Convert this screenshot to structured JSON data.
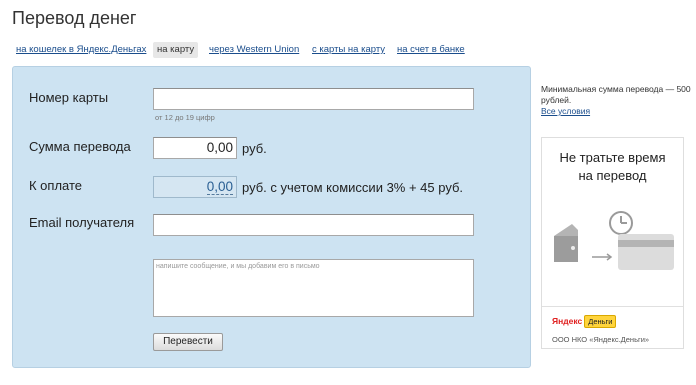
{
  "page": {
    "title": "Перевод денег"
  },
  "tabs": [
    {
      "label": "на кошелек в Яндекс.Деньгах"
    },
    {
      "label": "на карту"
    },
    {
      "label": "через Western Union"
    },
    {
      "label": "с карты на карту"
    },
    {
      "label": "на счет в банке"
    }
  ],
  "form": {
    "card_number_label": "Номер карты",
    "card_number_value": "",
    "card_number_hint": "от 12 до 19 цифр",
    "amount_label": "Сумма перевода",
    "amount_value": "0,00",
    "amount_currency": "руб.",
    "payment_label": "К оплате",
    "payment_value": "0,00",
    "payment_note": "руб. с учетом комиссии 3% + 45 руб.",
    "email_label": "Email получателя",
    "email_value": "",
    "message_placeholder": "напишите сообщение, и мы добавим его в письмо",
    "submit_label": "Перевести"
  },
  "sidebar": {
    "min_amount_text": "Минимальная сумма перевода — 500 рублей.",
    "all_terms_link": "Все условия"
  },
  "ad": {
    "headline_line1": "Не тратьте время",
    "headline_line2": "на перевод",
    "logo_ya": "Яндекс",
    "logo_dengi": "Деньги",
    "org": "ООО НКО «Яндекс.Деньги»"
  },
  "colors": {
    "panel_bg": "#cde3f2",
    "link": "#1a4d8c",
    "logo_red": "#e02020",
    "logo_yellow": "#ffd43c"
  }
}
